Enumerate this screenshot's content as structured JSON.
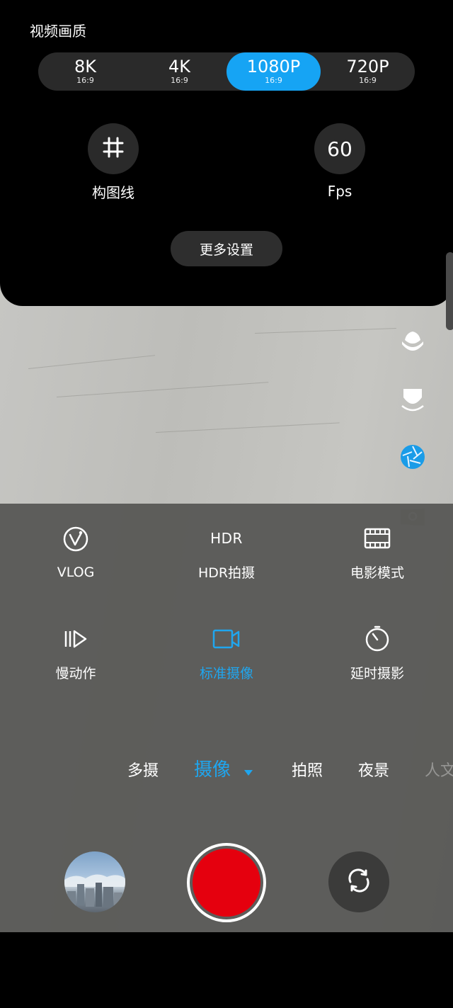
{
  "settings_panel": {
    "title": "视频画质",
    "resolutions": [
      {
        "label": "8K",
        "ratio": "16:9",
        "selected": false
      },
      {
        "label": "4K",
        "ratio": "16:9",
        "selected": false
      },
      {
        "label": "1080P",
        "ratio": "16:9",
        "selected": true
      },
      {
        "label": "720P",
        "ratio": "16:9",
        "selected": false
      }
    ],
    "grid_button": {
      "label": "构图线",
      "icon": "grid-icon"
    },
    "fps_button": {
      "value": "60",
      "label": "Fps"
    },
    "more_settings_label": "更多设置"
  },
  "side_icons": [
    "beauty-icon",
    "face-slim-icon",
    "aperture-icon",
    "camera-card-icon"
  ],
  "modes_grid": {
    "items": [
      {
        "label": "VLOG",
        "icon": "vlog-icon",
        "active": false
      },
      {
        "label": "HDR拍摄",
        "icon_text": "HDR",
        "active": false
      },
      {
        "label": "电影模式",
        "icon": "film-icon",
        "active": false
      },
      {
        "label": "慢动作",
        "icon": "slow-motion-icon",
        "active": false
      },
      {
        "label": "标准摄像",
        "icon": "video-camera-icon",
        "active": true
      },
      {
        "label": "延时摄影",
        "icon": "timer-icon",
        "active": false
      }
    ]
  },
  "mode_strip": {
    "items": [
      "多摄",
      "摄像",
      "拍照",
      "夜景",
      "人文"
    ],
    "active": "摄像"
  },
  "colors": {
    "accent": "#16a4f4",
    "active_mode_text": "#1fa6ef",
    "shutter_record": "#e5000e",
    "panel_bg": "#000000",
    "control_bg": "#2a2a2a"
  }
}
